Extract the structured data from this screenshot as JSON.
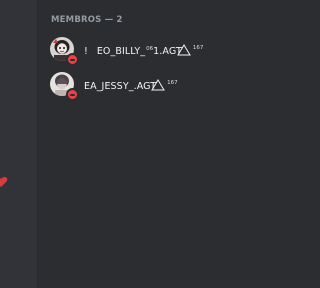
{
  "members_header": "MEMBROS — 2",
  "members": [
    {
      "prefix": "!",
      "name_main": "EO_BILLY_",
      "name_sup": "06",
      "name_tail": "1.AGT",
      "badge_sup": "167",
      "status": "dnd"
    },
    {
      "prefix": "",
      "name_main": "EA_JESSY_",
      "name_sup": "",
      "name_tail": ".AGT",
      "badge_sup": "167",
      "status": "dnd"
    }
  ],
  "colors": {
    "panel_bg": "#2b2d31",
    "chat_bg": "#313338",
    "header_text": "#949ba4",
    "name_text": "#f2f3f5",
    "status_dnd": "#f23f43",
    "heart": "#d83c3e"
  },
  "icons": {
    "heart": "heart-icon",
    "badge": "triangle-outline-icon"
  }
}
